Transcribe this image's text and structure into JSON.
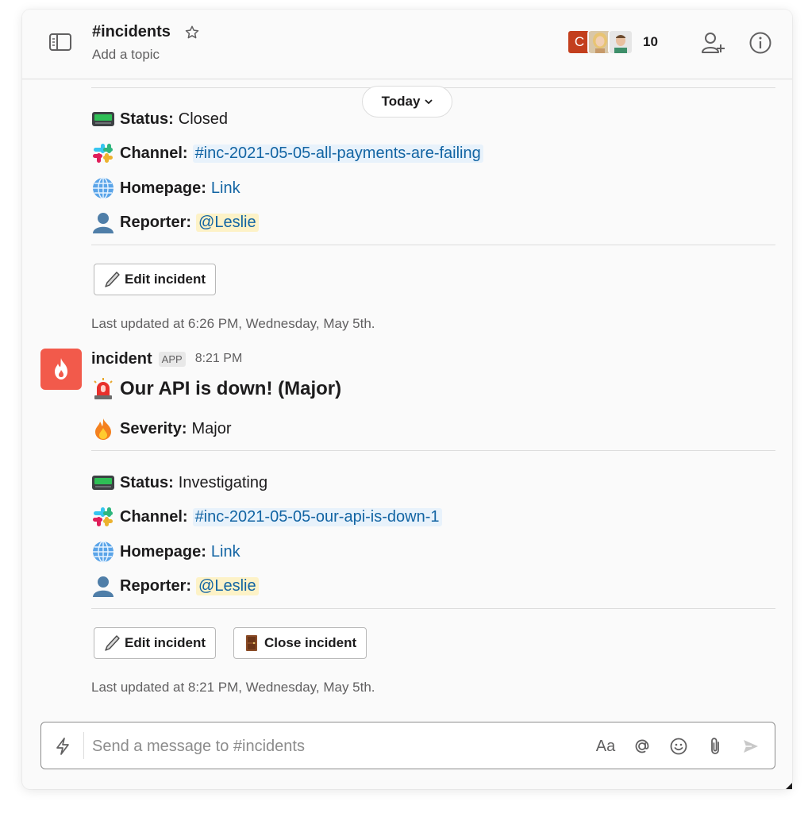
{
  "header": {
    "channel_name": "#incidents",
    "topic": "Add a topic",
    "avatar_initial": "C",
    "member_count": "10"
  },
  "today_label": "Today",
  "messages": [
    {
      "fields": {
        "status": {
          "key": "Status:",
          "value": "Closed"
        },
        "channel": {
          "key": "Channel:",
          "value": "#inc-2021-05-05-all-payments-are-failing"
        },
        "homepage": {
          "key": "Homepage:",
          "value": "Link"
        },
        "reporter": {
          "key": "Reporter:",
          "value": "@Leslie"
        }
      },
      "edit_label": "Edit incident",
      "updated": "Last updated at 6:26 PM, Wednesday, May 5th."
    },
    {
      "sender": "incident",
      "badge": "APP",
      "time": "8:21 PM",
      "title": "Our API is down! (Major)",
      "fields": {
        "severity": {
          "key": "Severity:",
          "value": "Major"
        },
        "status": {
          "key": "Status:",
          "value": "Investigating"
        },
        "channel": {
          "key": "Channel:",
          "value": "#inc-2021-05-05-our-api-is-down-1"
        },
        "homepage": {
          "key": "Homepage:",
          "value": "Link"
        },
        "reporter": {
          "key": "Reporter:",
          "value": "@Leslie"
        }
      },
      "edit_label": "Edit incident",
      "close_label": "Close incident",
      "updated": "Last updated at 8:21 PM, Wednesday, May 5th."
    }
  ],
  "composer": {
    "placeholder": "Send a message to #incidents",
    "format_label": "Aa"
  },
  "colors": {
    "app_avatar": "#f25a4b",
    "link": "#1264a3",
    "mention_bg": "#fdf2c7",
    "user_avatar": "#c33f1d"
  }
}
